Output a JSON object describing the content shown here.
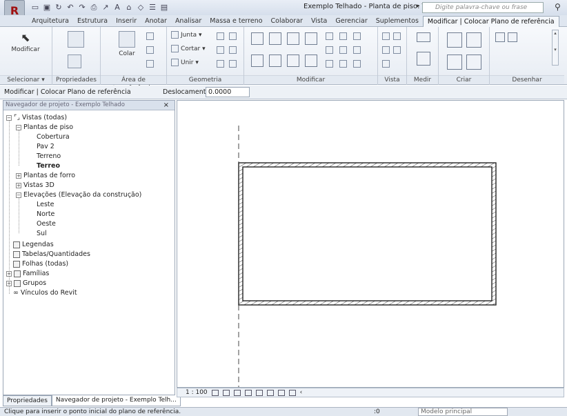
{
  "window": {
    "title": "Exemplo Telhado - Planta de piso: Terreo",
    "search_placeholder": "Digite palavra-chave ou frase",
    "app_letter": "R"
  },
  "ribbon": {
    "tabs": [
      "Arquitetura",
      "Estrutura",
      "Inserir",
      "Anotar",
      "Analisar",
      "Massa e terreno",
      "Colaborar",
      "Vista",
      "Gerenciar",
      "Suplementos",
      "Modificar | Colocar Plano de referência"
    ],
    "active_tab": "Modificar | Colocar Plano de referência",
    "panels": {
      "selecionar": "Selecionar ▾",
      "propriedades": "Propriedades",
      "area_transferencia": "Área de transferência",
      "geometria": "Geometria",
      "modificar": "Modificar",
      "vista": "Vista",
      "medir": "Medir",
      "criar": "Criar",
      "desenhar": "Desenhar"
    },
    "tools": {
      "modificar": "Modificar",
      "colar": "Colar",
      "junta": "Junta ▾",
      "cortar": "Cortar ▾",
      "unir": "Unir ▾"
    }
  },
  "options_bar": {
    "context": "Modificar | Colocar Plano de referência",
    "offset_label": "Deslocamento:",
    "offset_value": "0.0000"
  },
  "browser": {
    "header": "Navegador de projeto - Exemplo Telhado",
    "close": "×",
    "nodes": {
      "vistas": "Vistas (todas)",
      "plantas_piso": "Plantas de piso",
      "cobertura": "Cobertura",
      "pav2": "Pav 2",
      "terreno": "Terreno",
      "terreo": "Terreo",
      "plantas_forro": "Plantas de forro",
      "vistas3d": "Vistas 3D",
      "elevacoes": "Elevações (Elevação da construção)",
      "leste": "Leste",
      "norte": "Norte",
      "oeste": "Oeste",
      "sul": "Sul",
      "legendas": "Legendas",
      "tabelas": "Tabelas/Quantidades",
      "folhas": "Folhas (todas)",
      "familias": "Famílias",
      "grupos": "Grupos",
      "vinculos": "Vínculos do Revit"
    },
    "tabs": [
      "Propriedades",
      "Navegador de projeto - Exemplo Telh..."
    ]
  },
  "view_control": {
    "scale": "1 : 100"
  },
  "status": {
    "message": "Clique para inserir o ponto inicial do plano de referência.",
    "selection_count": ":0",
    "model": "Modelo principal"
  }
}
